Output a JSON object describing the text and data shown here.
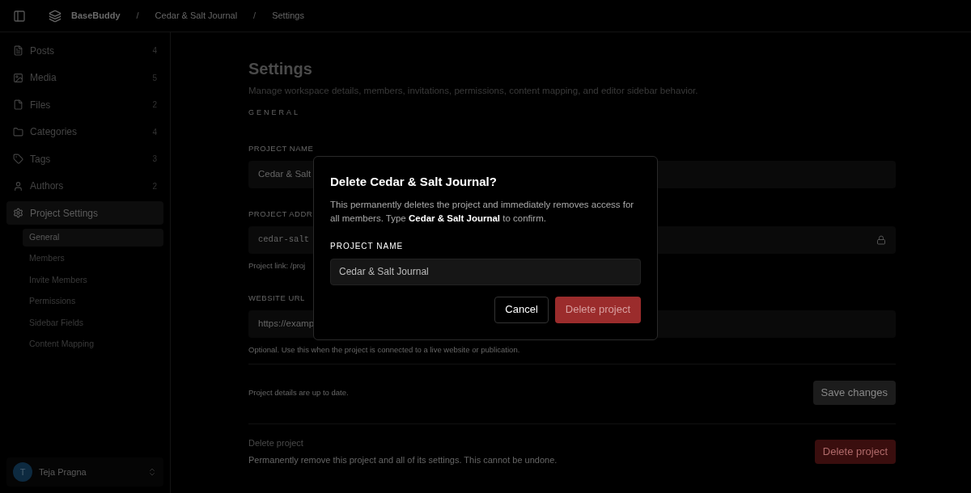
{
  "breadcrumb": {
    "app": "BaseBuddy",
    "items": [
      "Cedar & Salt Journal",
      "Settings"
    ],
    "separator": "/"
  },
  "sidebar": {
    "items": [
      {
        "label": "Posts",
        "count": "4",
        "kind": "posts",
        "selected": false
      },
      {
        "label": "Media",
        "count": "5",
        "kind": "media",
        "selected": false
      },
      {
        "label": "Files",
        "count": "2",
        "kind": "files",
        "selected": false
      },
      {
        "label": "Categories",
        "count": "4",
        "kind": "categories",
        "selected": false
      },
      {
        "label": "Tags",
        "count": "3",
        "kind": "tags",
        "selected": false
      },
      {
        "label": "Authors",
        "count": "2",
        "kind": "authors",
        "selected": false
      },
      {
        "label": "Project Settings",
        "kind": "settings",
        "selected": true,
        "children": [
          {
            "label": "General",
            "selected": true
          },
          {
            "label": "Members",
            "selected": false
          },
          {
            "label": "Invite Members",
            "selected": false
          },
          {
            "label": "Permissions",
            "selected": false
          },
          {
            "label": "Sidebar Fields",
            "selected": false
          },
          {
            "label": "Content Mapping",
            "selected": false
          }
        ]
      }
    ],
    "user": {
      "initial": "T",
      "name": "Teja Pragna"
    }
  },
  "page": {
    "title": "Settings",
    "subtitle": "Manage workspace details, members, invitations, permissions, content mapping, and editor sidebar behavior.",
    "section": "GENERAL",
    "fields": [
      {
        "label": "PROJECT NAME",
        "value": "Cedar & Salt",
        "locked": false,
        "mono": false
      },
      {
        "label": "PROJECT ADDR",
        "value": "cedar-salt",
        "locked": true,
        "mono": true,
        "hint": "Project link: /proj"
      },
      {
        "label": "WEBSITE URL",
        "value": "https://examp",
        "locked": false,
        "mono": false,
        "hint": "Optional. Use this when the project is connected to a live website or publication."
      }
    ],
    "status": "Project details are up to date.",
    "save_button": "Save changes",
    "danger": {
      "title": "Delete project",
      "text": "Permanently remove this project and all of its settings. This cannot be undone.",
      "button": "Delete project"
    }
  },
  "dialog": {
    "title": "Delete Cedar & Salt Journal?",
    "text": "This permanently deletes the project and immediately removes access for all members. Type **Cedar & Salt Journal** to confirm.",
    "field_label": "PROJECT NAME",
    "field_value": "Cedar & Salt Journal",
    "cancel": "Cancel",
    "confirm": "Delete project"
  }
}
